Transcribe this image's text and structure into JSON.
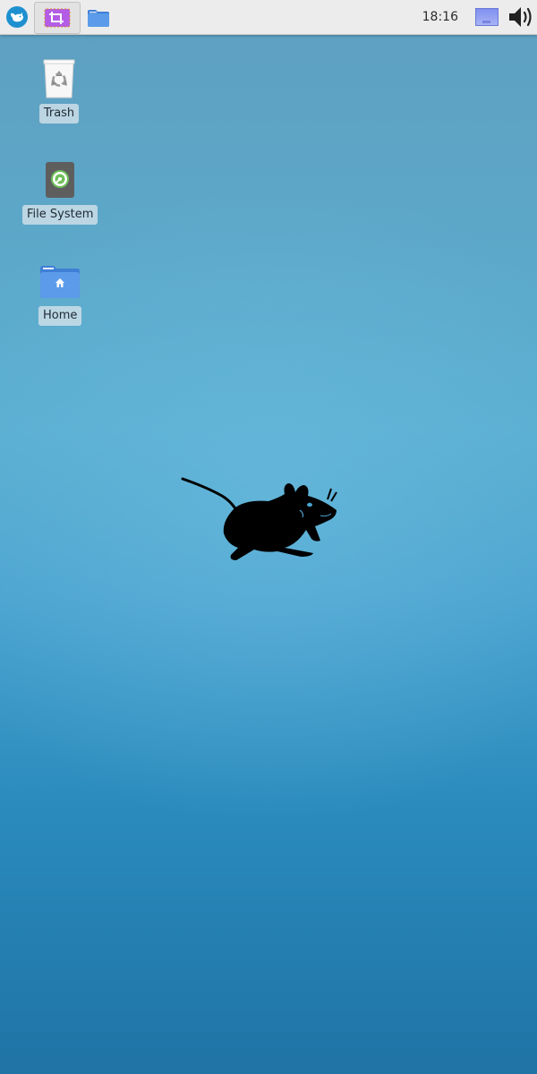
{
  "panel": {
    "clock": "18:16",
    "buttons": [
      {
        "name": "whisker-menu",
        "icon": "xfce-mouse-icon"
      },
      {
        "name": "screenshot-task",
        "icon": "crop-icon"
      },
      {
        "name": "file-manager-task",
        "icon": "folder-icon"
      },
      {
        "name": "workspace-pager",
        "icon": "workspace-icon"
      },
      {
        "name": "volume",
        "icon": "speaker-icon"
      }
    ]
  },
  "desktop": {
    "icons": [
      {
        "label": "Trash",
        "icon": "trash-icon"
      },
      {
        "label": "File System",
        "icon": "drive-icon"
      },
      {
        "label": "Home",
        "icon": "home-folder-icon"
      }
    ],
    "wallpaper": "xfce-mouse-logo"
  },
  "colors": {
    "panel_bg": "#ececec",
    "accent": "#1e90d0",
    "folder_blue": "#4f8fe0",
    "crop_purple": "#b35ce6"
  }
}
